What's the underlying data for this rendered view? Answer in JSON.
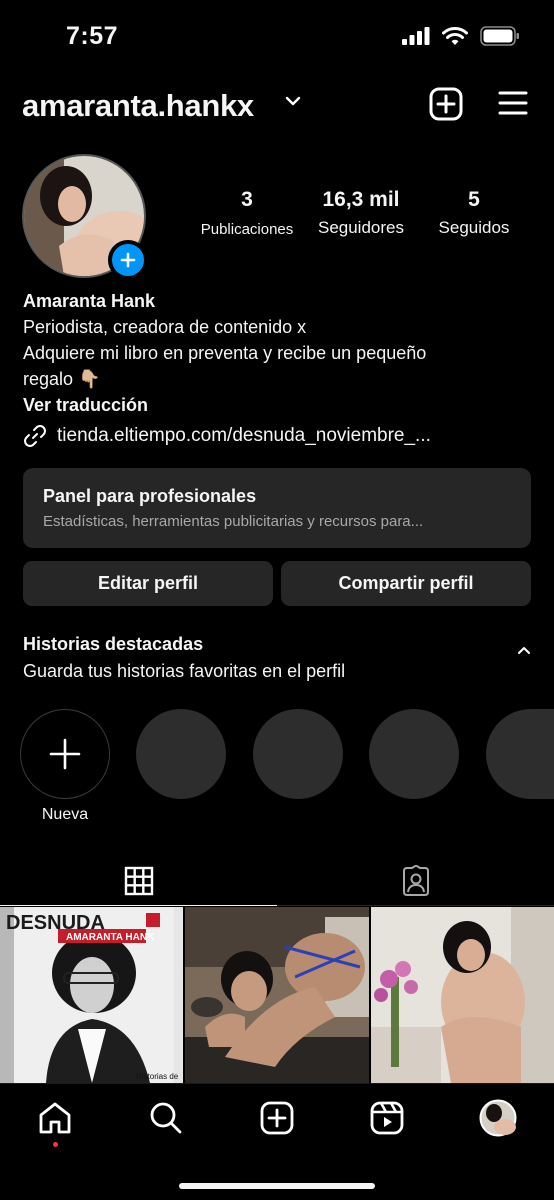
{
  "status_bar": {
    "time": "7:57"
  },
  "header": {
    "username": "amaranta.hankx"
  },
  "profile": {
    "stats": [
      {
        "value": "3",
        "label": "Publicaciones"
      },
      {
        "value": "16,3 mil",
        "label": "Seguidores"
      },
      {
        "value": "5",
        "label": "Seguidos"
      }
    ],
    "name": "Amaranta Hank",
    "bio_line1": "Periodista, creadora de contenido x",
    "bio_line2": "Adquiere mi libro en preventa y recibe un pequeño",
    "bio_line3": "regalo 👇🏼",
    "translate": "Ver traducción",
    "link": "tienda.eltiempo.com/desnuda_noviembre_..."
  },
  "pro_panel": {
    "title": "Panel para profesionales",
    "subtitle": "Estadísticas, herramientas publicitarias y recursos para..."
  },
  "buttons": {
    "edit": "Editar perfil",
    "share": "Compartir perfil"
  },
  "highlights": {
    "title": "Historias destacadas",
    "subtitle": "Guarda tus historias favoritas en el perfil",
    "new_label": "Nueva"
  },
  "posts": [
    {
      "cover_title": "DESNUDA",
      "cover_author": "AMARANTA HANK",
      "caption": "Historias de"
    },
    {},
    {}
  ],
  "colors": {
    "accent": "#0095f6",
    "notification": "#ff3040",
    "surface": "#262626"
  }
}
